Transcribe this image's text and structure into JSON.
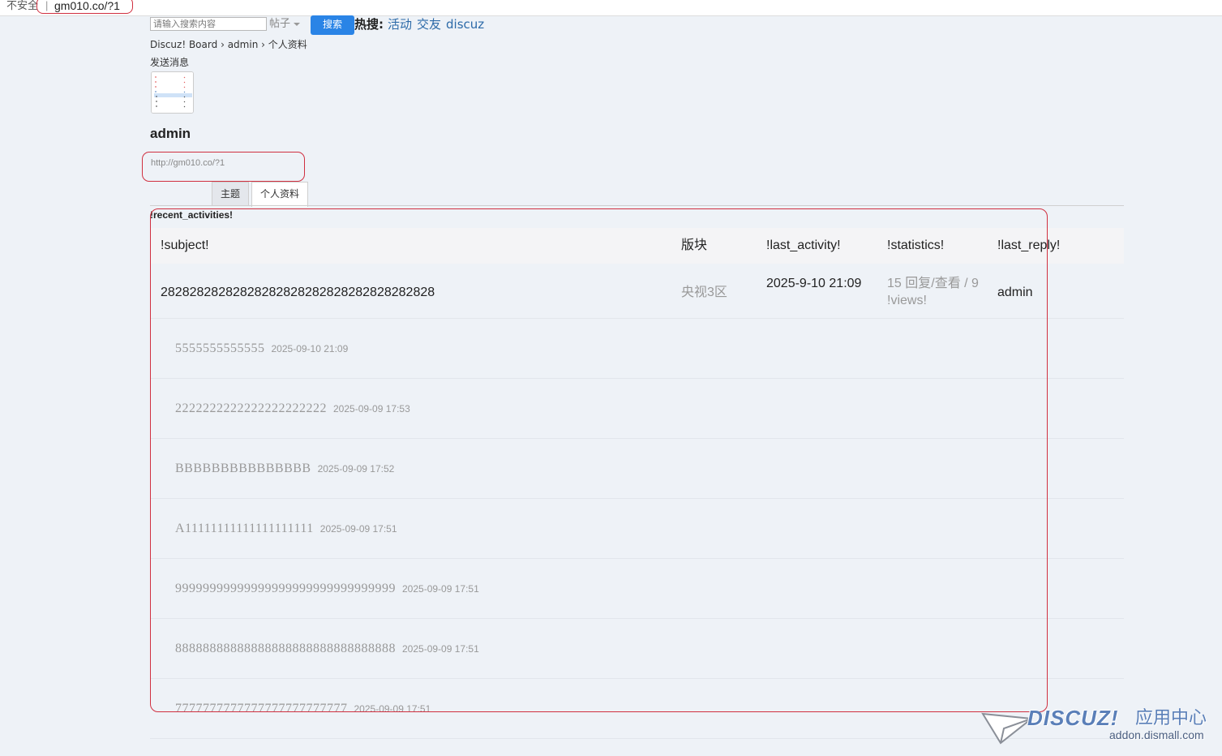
{
  "browser": {
    "insecure_label": "不安全",
    "url": "gm010.co/?1"
  },
  "search": {
    "placeholder": "请输入搜索内容",
    "type_label": "帖子",
    "button_label": "搜索",
    "hot_label": "热搜:",
    "hot_links": [
      "活动",
      "交友",
      "discuz"
    ]
  },
  "breadcrumb": {
    "items": [
      "Discuz! Board",
      "admin",
      "个人资料"
    ],
    "separator": "›"
  },
  "profile": {
    "send_message": "发送消息",
    "username": "admin",
    "site_url": "http://gm010.co/?1"
  },
  "tabs": [
    {
      "label": "主题",
      "active": false
    },
    {
      "label": "个人资料",
      "active": true
    }
  ],
  "content": {
    "section_title": "!recent_activities!",
    "columns": [
      "!subject!",
      "版块",
      "!last_activity!",
      "!statistics!",
      "!last_reply!"
    ],
    "thread": {
      "subject": "28282828282828282828282828282828282828",
      "forum": "央视3区",
      "last_activity": "2025-9-10 21:09",
      "statistics": "15 回复/查看 / 9 !views!",
      "last_reply": "admin"
    },
    "posts": [
      {
        "title": "5555555555555",
        "date": "2025-09-10 21:09"
      },
      {
        "title": "2222222222222222222222",
        "date": "2025-09-09 17:53"
      },
      {
        "title": "BBBBBBBBBBBBBBB",
        "date": "2025-09-09 17:52"
      },
      {
        "title": "A11111111111111111111",
        "date": "2025-09-09 17:51"
      },
      {
        "title": "99999999999999999999999999999999",
        "date": "2025-09-09 17:51"
      },
      {
        "title": "88888888888888888888888888888888",
        "date": "2025-09-09 17:51"
      },
      {
        "title": "7777777777777777777777777",
        "date": "2025-09-09 17:51"
      }
    ]
  },
  "watermark": {
    "logo": "DISCUZ!",
    "cn": "应用中心",
    "site": "addon.dismall.com"
  },
  "colors": {
    "page_bg": "#eef2f7",
    "accent_button": "#2a84e6",
    "link": "#2c6aa8",
    "annotation_red": "#d03040",
    "muted_text": "#999999"
  }
}
